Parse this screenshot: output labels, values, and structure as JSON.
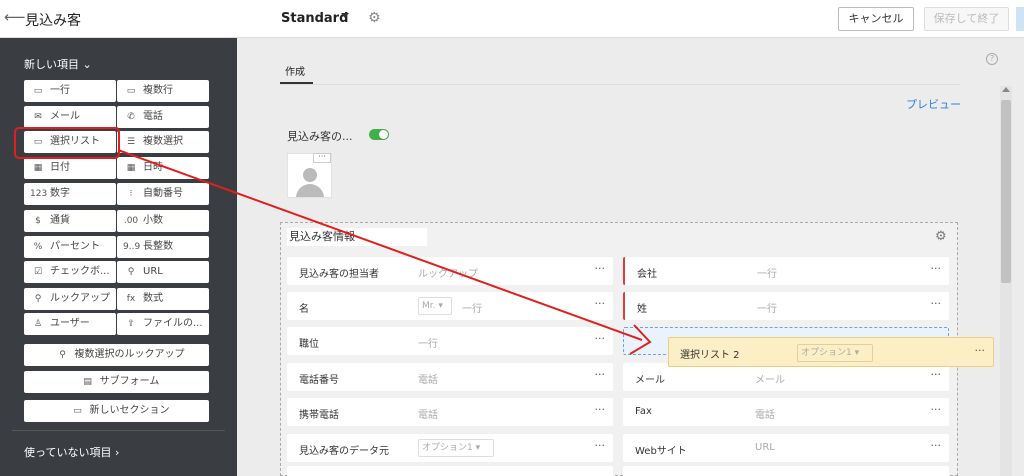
{
  "topbar": {
    "back_icon": "arrow-left-icon",
    "title": "見込み客",
    "layout_name": "Standard",
    "cancel_label": "キャンセル",
    "save_label": "保存して終了"
  },
  "sidebar": {
    "new_items_label": "新しい項目",
    "tiles": [
      {
        "label": "一行",
        "icon": "▭"
      },
      {
        "label": "複数行",
        "icon": "▭"
      },
      {
        "label": "メール",
        "icon": "✉"
      },
      {
        "label": "電話",
        "icon": "✆"
      },
      {
        "label": "選択リスト",
        "icon": "▭"
      },
      {
        "label": "複数選択",
        "icon": "☰"
      },
      {
        "label": "日付",
        "icon": "▦"
      },
      {
        "label": "日時",
        "icon": "▦"
      },
      {
        "label": "数字",
        "icon": "123"
      },
      {
        "label": "自動番号",
        "icon": "⁝"
      },
      {
        "label": "通貨",
        "icon": "$"
      },
      {
        "label": "小数",
        "icon": ".00"
      },
      {
        "label": "パーセント",
        "icon": "%"
      },
      {
        "label": "長整数",
        "icon": "9..9"
      },
      {
        "label": "チェックボ...",
        "icon": "☑"
      },
      {
        "label": "URL",
        "icon": "⚲"
      },
      {
        "label": "ルックアップ",
        "icon": "⚲"
      },
      {
        "label": "数式",
        "icon": "fx"
      },
      {
        "label": "ユーザー",
        "icon": "♙"
      },
      {
        "label": "ファイルの...",
        "icon": "⇪"
      }
    ],
    "wide_items": [
      {
        "label": "複数選択のルックアップ",
        "icon": "⚲"
      },
      {
        "label": "サブフォーム",
        "icon": "▤"
      },
      {
        "label": "新しいセクション",
        "icon": "▭"
      }
    ],
    "unused_label": "使っていない項目"
  },
  "main": {
    "tab_label": "作成",
    "preview_label": "プレビュー",
    "photo_label": "見込み客の...",
    "section_title": "見込み客情報",
    "fields_left": [
      {
        "label": "見込み客の担当者",
        "placeholder": "ルックアップ"
      },
      {
        "label": "名",
        "salutation": "Mr.",
        "placeholder": "一行"
      },
      {
        "label": "職位",
        "placeholder": "一行"
      },
      {
        "label": "電話番号",
        "placeholder": "電話"
      },
      {
        "label": "携帯電話",
        "placeholder": "電話"
      },
      {
        "label": "見込み客のデータ元",
        "placeholder": "オプション1"
      }
    ],
    "fields_right": [
      {
        "label": "会社",
        "placeholder": "一行"
      },
      {
        "label": "姓",
        "placeholder": "一行"
      },
      {
        "label": "メール",
        "placeholder": "メール"
      },
      {
        "label": "Fax",
        "placeholder": "電話"
      },
      {
        "label": "Webサイト",
        "placeholder": "URL"
      }
    ],
    "dragged_field": {
      "label": "選択リスト 2",
      "placeholder": "オプション1"
    },
    "dots": "···"
  },
  "colors": {
    "annotation_red": "#e02020",
    "accent_blue": "#2d7de0",
    "toggle_green": "#41b04b",
    "sidebar_bg": "#3a3d42"
  }
}
